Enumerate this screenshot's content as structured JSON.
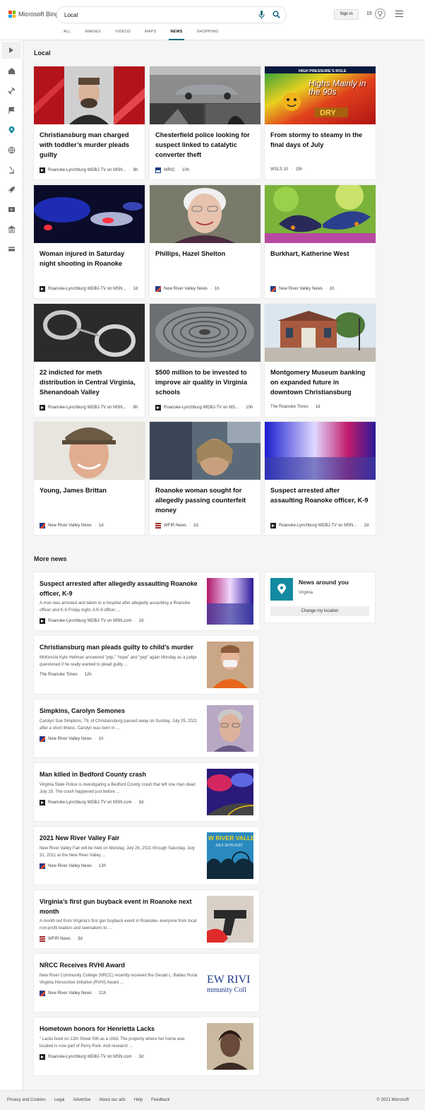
{
  "brand": {
    "name": "Microsoft Bing"
  },
  "search": {
    "query": "Local"
  },
  "header": {
    "sign_in": "Sign in",
    "rewards": "15"
  },
  "nav": {
    "tabs": [
      "ALL",
      "IMAGES",
      "VIDEOS",
      "MAPS",
      "NEWS",
      "SHOPPING"
    ],
    "active": "NEWS"
  },
  "local": {
    "title": "Local",
    "cards": [
      {
        "title": "Christiansburg man charged with toddler’s murder pleads guilty",
        "source": "Roanoke-Lynchburg WDBJ-TV on MSN...",
        "age": "9h"
      },
      {
        "title": "Chesterfield police looking for suspect linked to catalytic converter theft",
        "source": "WRIC",
        "age": "10h"
      },
      {
        "title": "From stormy to steamy in the final days of July",
        "source": "WSLS 10",
        "age": "15h"
      },
      {
        "title": "Woman injured in Saturday night shooting in Roanoke",
        "source": "Roanoke-Lynchburg WDBJ-TV on MSN...",
        "age": "1d"
      },
      {
        "title": "Phillips, Hazel Shelton",
        "source": "New River Valley News",
        "age": "1h"
      },
      {
        "title": "Burkhart, Katherine West",
        "source": "New River Valley News",
        "age": "1h"
      },
      {
        "title": "22 indicted for meth distribution in Central Virginia, Shenandoah Valley",
        "source": "Roanoke-Lynchburg WDBJ-TV on MSN...",
        "age": "8h"
      },
      {
        "title": "$500 million to be invested to improve air quality in Virginia schools",
        "source": "Roanoke-Lynchburg WDBJ-TV on MS...",
        "age": "10h"
      },
      {
        "title": "Montgomery Museum banking on expanded future in downtown Christiansburg",
        "source": "The Roanoke Times",
        "age": "1d"
      },
      {
        "title": "Young, James Brittan",
        "source": "New River Valley News",
        "age": "1d"
      },
      {
        "title": "Roanoke woman sought for allegedly passing counterfeit money",
        "source": "WFIR News",
        "age": "2d"
      },
      {
        "title": "Suspect arrested after assaulting Roanoke officer, K-9",
        "source": "Roanoke-Lynchburg WDBJ-TV on MSN...",
        "age": "2d"
      }
    ],
    "weather_graphic": {
      "banner": "HIGH PRESSURE’S ROLE",
      "headline": "Highs Mainly in the 90s",
      "tag": "DRY"
    }
  },
  "more_news": {
    "title": "More news",
    "items": [
      {
        "title": "Suspect arrested after allegedly assaulting Roanoke officer, K-9",
        "desc": "A man was arrested and taken to a hospital after allegedly assaulting a Roanoke officer and K-9 Friday night. A K-9 officer ...",
        "source": "Roanoke-Lynchburg WDBJ-TV on MSN.com",
        "age": "2d"
      },
      {
        "title": "Christiansburg man pleads guilty to child’s murder",
        "desc": "McKenzie Kyle Hellman answered “yep,” “nope” and “yep” again Monday as a judge questioned if he really wanted to plead guilty ...",
        "source": "The Roanoke Times",
        "age": "12h"
      },
      {
        "title": "Simpkins, Carolyn Semones",
        "desc": "Carolyn Sue Simpkins, 79, of Christiansburg passed away on Sunday, July 25, 2021 after a short illness. Carolyn was born in ...",
        "source": "New River Valley News",
        "age": "1h"
      },
      {
        "title": "Man killed in Bedford County crash",
        "desc": "Virginia State Police is investigating a Bedford County crash that left one man dead July 19. The crash happened just before ...",
        "source": "Roanoke-Lynchburg WDBJ-TV on MSN.com",
        "age": "3d"
      },
      {
        "title": "2021 New River Valley Fair",
        "desc": "New River Valley Fair will be held on Monday, July 26, 2021 through Saturday, July 31, 2021 at the New River Valley ...",
        "source": "New River Valley News",
        "age": "13h"
      },
      {
        "title": "Virginia’s first gun buyback event in Roanoke next month",
        "desc": "A month out from Virginia’s first gun buyback event in Roanoke, everyone from local non-profit leaders and lawmakers to ...",
        "source": "WFIR News",
        "age": "3d"
      },
      {
        "title": "NRCC Receives RVHI Award",
        "desc": "New River Community College (NRCC) recently received the Gerald L. Baliles Rural Virginia Horseshoe Initiative (RVHI) Award ...",
        "source": "New River Valley News",
        "age": "21h"
      },
      {
        "title": "Hometown honors for Henrietta Lacks",
        "desc": "“ Lacks lived on 12th Street SW as a child. The property where her home was located is now part of Perry Park. And research ...",
        "source": "Roanoke-Lynchburg WDBJ-TV on MSN.com",
        "age": "3d"
      }
    ],
    "fair_graphic": {
      "line1": "W RIVER VALLEY F",
      "line2": "JULY 26TH-31ST"
    },
    "nrcc_graphic": {
      "line1": "EW RIVI",
      "line2": "mmunity Coll"
    }
  },
  "around": {
    "title": "News around you",
    "location": "Virginia",
    "button": "Change my location"
  },
  "footer": {
    "links": [
      "Privacy and Cookies",
      "Legal",
      "Advertise",
      "About our ads",
      "Help",
      "Feedback"
    ],
    "copyright": "© 2021 Microsoft"
  },
  "colors": {
    "accent": "#0c6a7d",
    "pin": "#138aa0"
  }
}
